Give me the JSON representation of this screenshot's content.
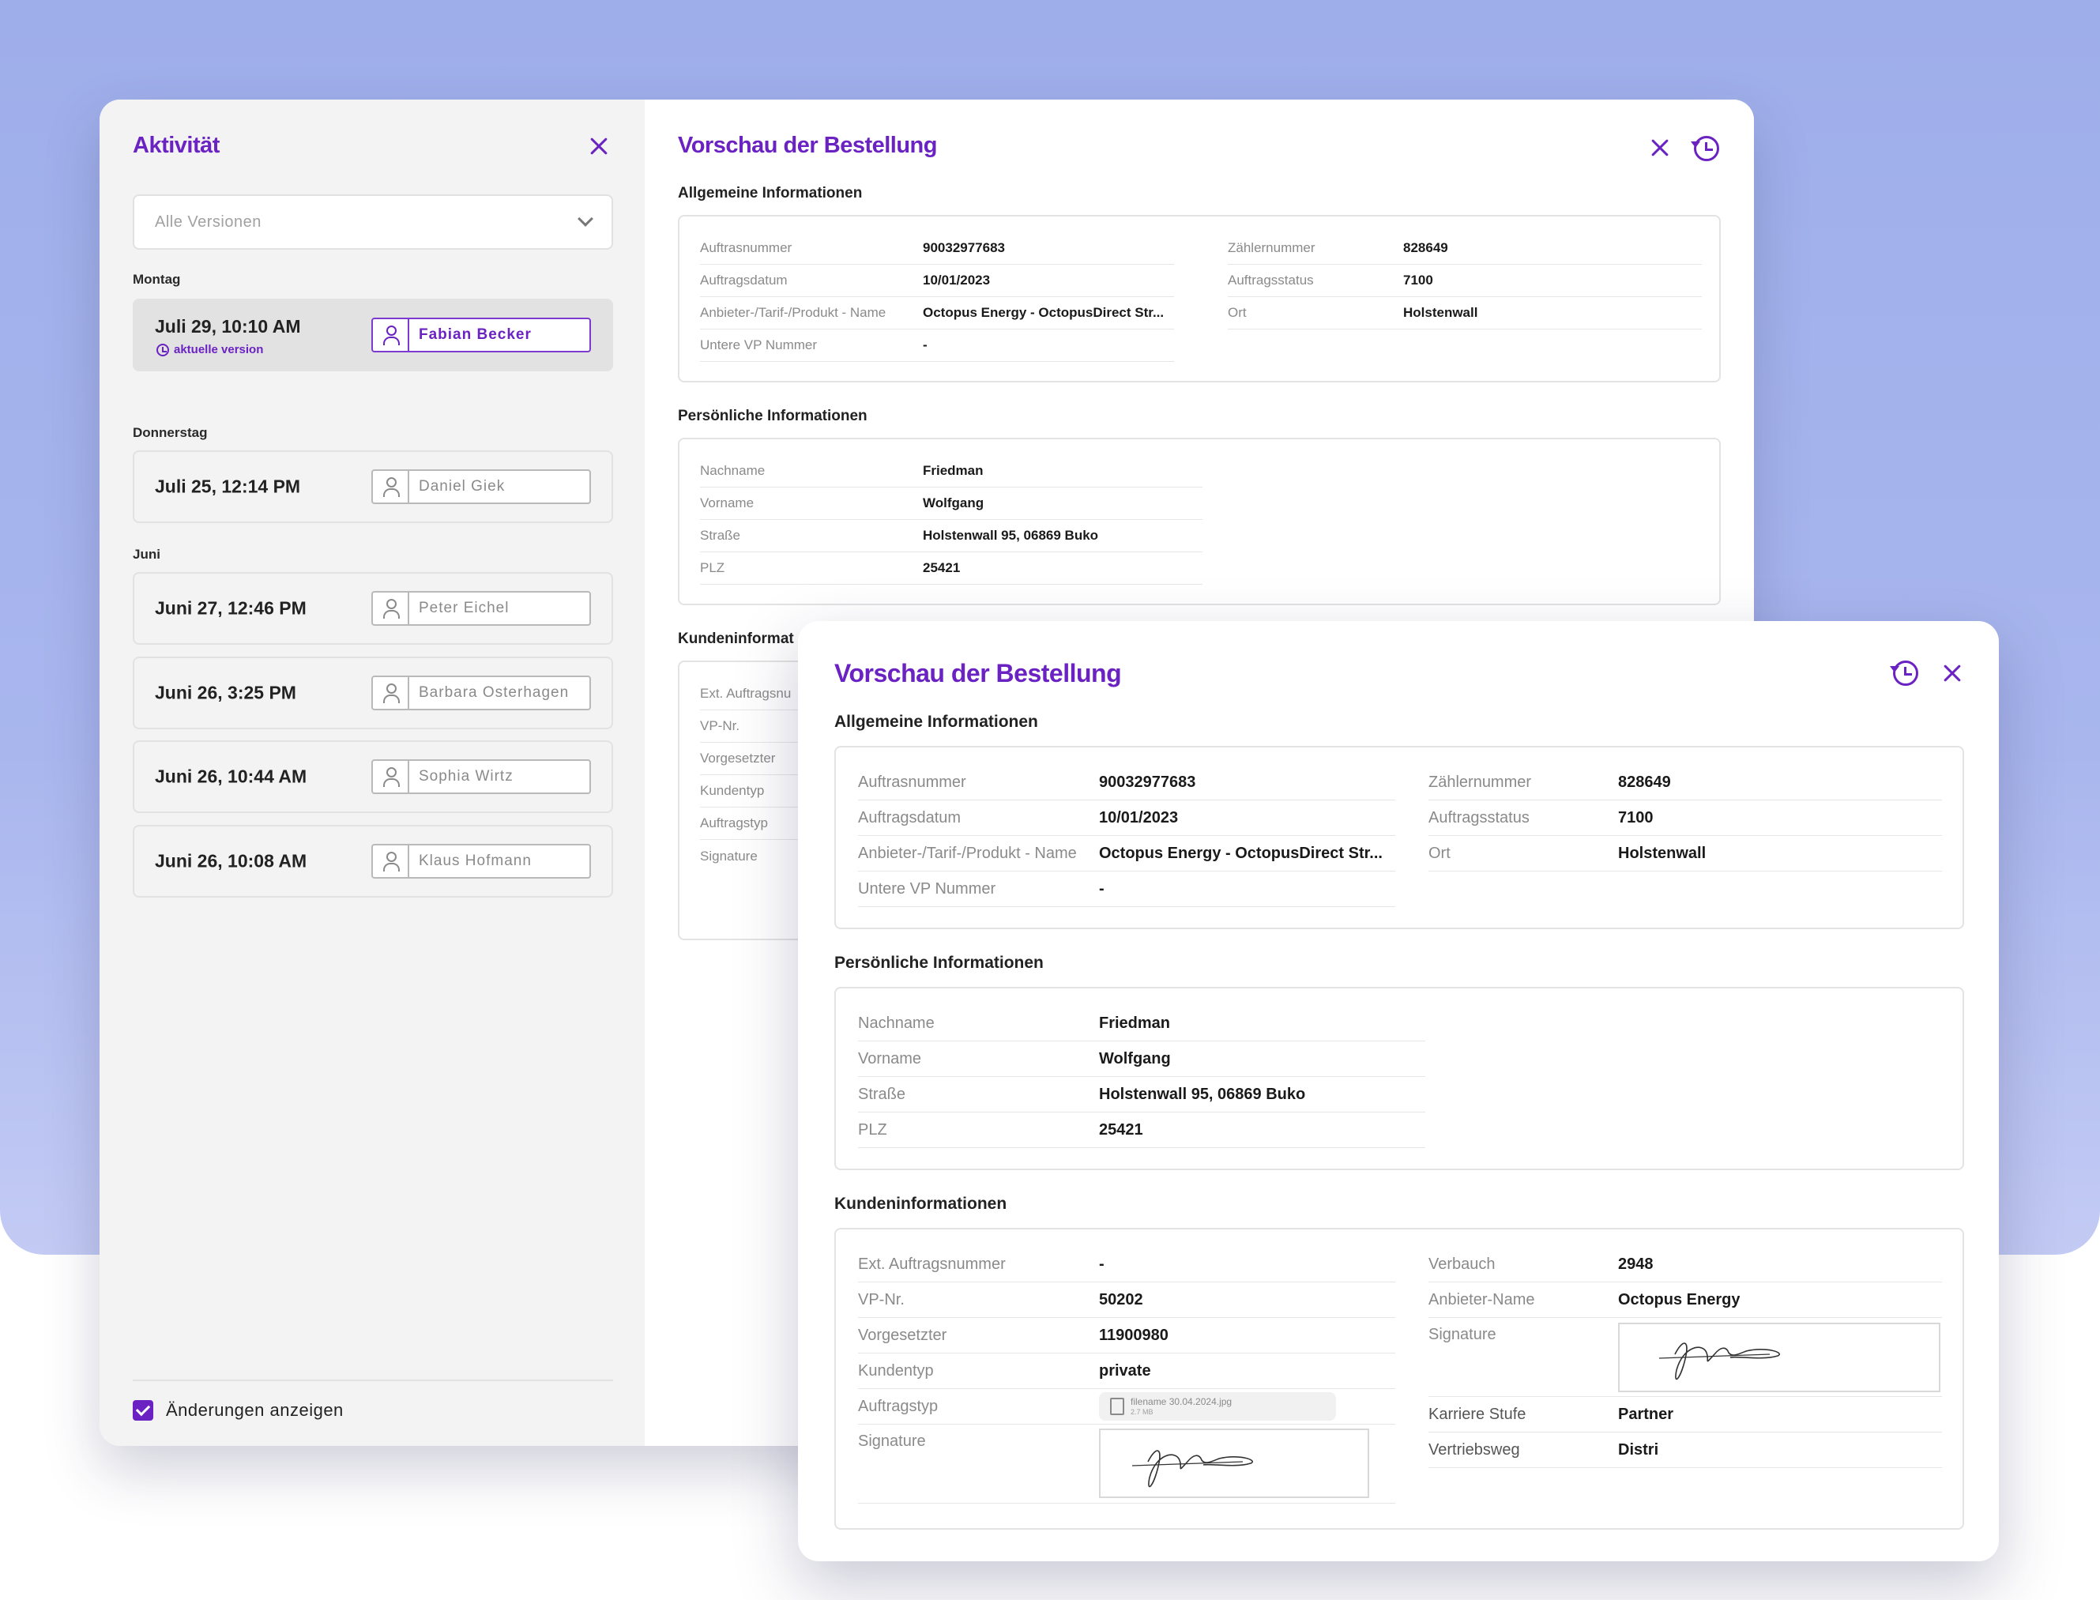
{
  "activity": {
    "title": "Aktivität",
    "version_select": "Alle Versionen",
    "groups": [
      {
        "day": "Montag",
        "entries": [
          {
            "when": "Juli 29, 10:10 AM",
            "user": "Fabian Becker",
            "current_label": "aktuelle version",
            "active": true
          }
        ]
      },
      {
        "day": "Donnerstag",
        "entries": [
          {
            "when": "Juli 25, 12:14 PM",
            "user": "Daniel Giek"
          }
        ]
      },
      {
        "day": "Juni",
        "entries": [
          {
            "when": "Juni 27, 12:46 PM",
            "user": "Peter Eichel"
          },
          {
            "when": "Juni 26, 3:25 PM",
            "user": "Barbara Osterhagen"
          },
          {
            "when": "Juni 26, 10:44 AM",
            "user": "Sophia Wirtz"
          },
          {
            "when": "Juni 26, 10:08 AM",
            "user": "Klaus Hofmann"
          }
        ]
      }
    ],
    "show_changes": "Änderungen anzeigen"
  },
  "preview": {
    "title": "Vorschau der Bestellung",
    "general": {
      "title": "Allgemeine Informationen",
      "left": [
        {
          "label": "Auftrasnummer",
          "value": "90032977683"
        },
        {
          "label": "Auftragsdatum",
          "value": "10/01/2023"
        },
        {
          "label": "Anbieter-/Tarif-/Produkt - Name",
          "value": "Octopus Energy - OctopusDirect Str..."
        },
        {
          "label": "Untere VP Nummer",
          "value": "-"
        }
      ],
      "right": [
        {
          "label": "Zählernummer",
          "value": "828649"
        },
        {
          "label": "Auftragsstatus",
          "value": "7100"
        },
        {
          "label": "Ort",
          "value": "Holstenwall"
        }
      ]
    },
    "personal": {
      "title": "Persönliche Informationen",
      "rows": [
        {
          "label": "Nachname",
          "value": "Friedman"
        },
        {
          "label": "Vorname",
          "value": "Wolfgang"
        },
        {
          "label": "Straße",
          "value": "Holstenwall 95, 06869 Buko"
        },
        {
          "label": "PLZ",
          "value": "25421"
        }
      ]
    },
    "customer": {
      "title": "Kundeninformationen",
      "back_title": "Kundeninformat",
      "back_labels": [
        "Ext. Auftragsnu",
        "VP-Nr.",
        "Vorgesetzter",
        "Kundentyp",
        "Auftragstyp",
        "Signature"
      ],
      "left": [
        {
          "label": "Ext. Auftragsnummer",
          "value": "-"
        },
        {
          "label": "VP-Nr.",
          "value": "50202"
        },
        {
          "label": "Vorgesetzter",
          "value": "11900980"
        },
        {
          "label": "Kundentyp",
          "value": "private"
        },
        {
          "label": "Auftragstyp",
          "value": ""
        },
        {
          "label": "Signature",
          "value": ""
        }
      ],
      "right": [
        {
          "label": "Verbauch",
          "value": "2948"
        },
        {
          "label": "Anbieter-Name",
          "value": "Octopus Energy"
        },
        {
          "label": "Signature",
          "value": ""
        },
        {
          "label": "Karriere Stufe",
          "value": "Partner"
        },
        {
          "label": "Vertriebsweg",
          "value": "Distri"
        }
      ],
      "file": {
        "name": "filename 30.04.2024.jpg",
        "size": "2.7 MB"
      }
    }
  },
  "colors": {
    "accent": "#6b22c2",
    "background": "#9eaeea"
  }
}
